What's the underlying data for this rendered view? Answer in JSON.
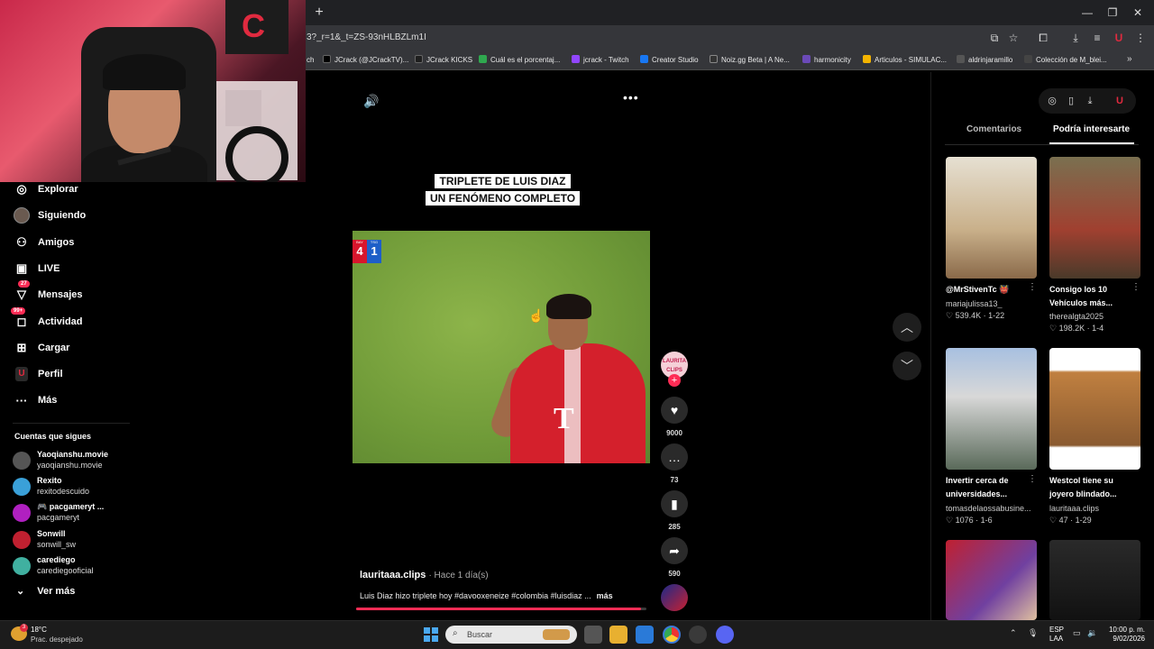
{
  "browser": {
    "url": "3?_r=1&_t=ZS-93nHLBZLm1I",
    "new_tab_label": "+",
    "window_controls": [
      "—",
      "❐",
      "✕"
    ],
    "bookmarks": [
      {
        "label": "ch",
        "color": "#222222"
      },
      {
        "label": "JCrack (@JCrackTV)...",
        "color": "#000000"
      },
      {
        "label": "JCrack KICKS",
        "color": "#1f1f1f"
      },
      {
        "label": "Cuál es el porcentaj...",
        "color": "#2fa84f"
      },
      {
        "label": "jcrack - Twitch",
        "color": "#9146ff"
      },
      {
        "label": "Creator Studio",
        "color": "#1877f2"
      },
      {
        "label": "Noiz.gg Beta | A Ne...",
        "color": "#333333"
      },
      {
        "label": "harmonicity",
        "color": "#6b4ab8"
      },
      {
        "label": "Articulos - SIMULAC...",
        "color": "#f4b400"
      },
      {
        "label": "aldrinjaramillo",
        "color": "#555555"
      },
      {
        "label": "Colección de M_blei...",
        "color": "#444444"
      }
    ],
    "more_bookmarks": "»"
  },
  "cam": {
    "poster_letter": "C"
  },
  "sidebar": {
    "nav": [
      {
        "label": "Explorar",
        "icon": "compass-icon",
        "glyph": "◎",
        "badge": ""
      },
      {
        "label": "Siguiendo",
        "icon": "following-avatar-icon",
        "glyph": "●",
        "badge": ""
      },
      {
        "label": "Amigos",
        "icon": "friends-icon",
        "glyph": "👥",
        "badge": ""
      },
      {
        "label": "LIVE",
        "icon": "live-icon",
        "glyph": "▣",
        "badge": ""
      },
      {
        "label": "Mensajes",
        "icon": "messages-icon",
        "glyph": "✉",
        "badge": "27"
      },
      {
        "label": "Actividad",
        "icon": "activity-icon",
        "glyph": "◆",
        "badge": "99+"
      },
      {
        "label": "Cargar",
        "icon": "upload-icon",
        "glyph": "⊞",
        "badge": ""
      },
      {
        "label": "Perfil",
        "icon": "profile-icon",
        "glyph": "U",
        "badge": ""
      },
      {
        "label": "Más",
        "icon": "more-icon",
        "glyph": "···",
        "badge": ""
      }
    ],
    "following_title": "Cuentas que sigues",
    "accounts": [
      {
        "name": "Yaoqianshu.movie",
        "handle": "yaoqianshu.movie",
        "color": "#555555"
      },
      {
        "name": "Rexito",
        "handle": "rexitodescuido",
        "color": "#3aa0d8"
      },
      {
        "name": "🎮 pacgameryt ...",
        "handle": "pacgameryt",
        "color": "#b020c0"
      },
      {
        "name": "Sonwill",
        "handle": "sonwill_sw",
        "color": "#c02030"
      },
      {
        "name": "carediego",
        "handle": "carediegooficial",
        "color": "#40b0a0"
      }
    ],
    "see_more": "Ver más"
  },
  "video": {
    "caption_lines": [
      "TRIPLETE DE LUIS DIAZ",
      "UN FENÓMENO COMPLETO"
    ],
    "score_home": "4",
    "score_away": "1",
    "score_home_tag": "BAY",
    "score_away_tag": "TSG",
    "shirt_logo": "T",
    "author": "lauritaaa.clips",
    "time": "· Hace 1 día(s)",
    "description": "Luis Diaz hizo triplete hoy #davooxeneize #colombia #luisdiaz ...",
    "more": "más",
    "progress": 0.98,
    "creator_avatar_text": "LAURITA CLIPS"
  },
  "actions": {
    "likes": "9000",
    "comments": "73",
    "saves": "285",
    "shares": "590"
  },
  "right_panel": {
    "tabs": [
      "Comentarios",
      "Podría interesarte"
    ],
    "active_tab": 1,
    "cards": [
      {
        "title": "@MrStivenTc 👹",
        "user": "mariajulissa13_",
        "stats": "♡ 539.4K · 1-22",
        "colors": [
          "#d8d0c0",
          "#8a6a4a"
        ]
      },
      {
        "title": "Consigo los 10 Vehículos más...",
        "user": "therealgta2025",
        "stats": "♡ 198.2K · 1-4",
        "colors": [
          "#6a6040",
          "#c02030"
        ]
      },
      {
        "title": "Invertir cerca de universidades...",
        "user": "tomasdelaossabusine...",
        "stats": "♡ 1076 · 1-6",
        "colors": [
          "#a0b8d8",
          "#5a6a5a"
        ]
      },
      {
        "title": "Westcol tiene su joyero blindado...",
        "user": "lauritaaa.clips",
        "stats": "♡ 47 · 1-29",
        "colors": [
          "#ffffff",
          "#c08040"
        ]
      },
      {
        "title": "",
        "user": "",
        "stats": "",
        "colors": [
          "#c02030",
          "#7040a0"
        ]
      },
      {
        "title": "",
        "user": "",
        "stats": "",
        "colors": [
          "#303030",
          "#1a1a1a"
        ]
      }
    ]
  },
  "taskbar": {
    "temp": "18°C",
    "weather": "Prac. despejado",
    "weather_badge": "3",
    "search_placeholder": "Buscar",
    "lang_top": "ESP",
    "lang_bottom": "LAA",
    "time": "10:00 p. m.",
    "date": "9/02/2026"
  }
}
